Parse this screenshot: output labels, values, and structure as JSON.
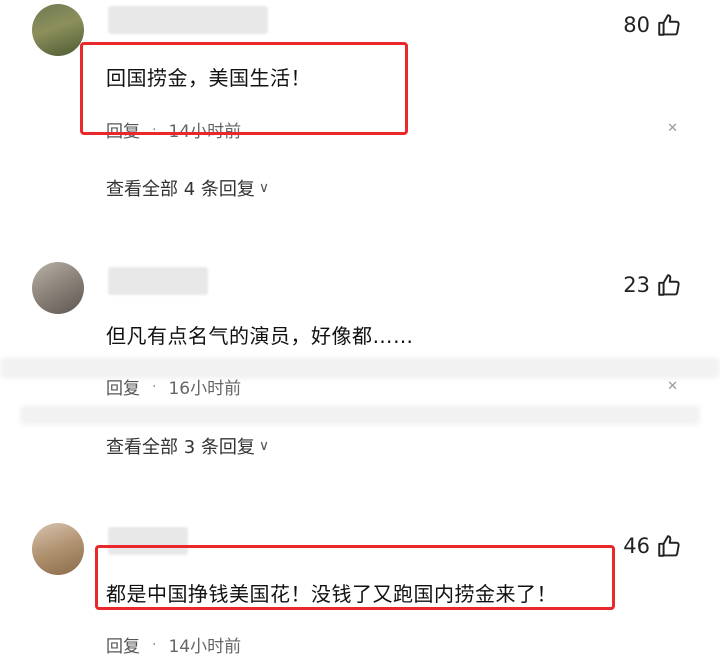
{
  "comments": [
    {
      "likes": "80",
      "text": "回国捞金，美国生活！",
      "reply_label": "回复",
      "time": "14小时前",
      "view_all": "查看全部 4 条回复"
    },
    {
      "likes": "23",
      "text": "但凡有点名气的演员，好像都……",
      "reply_label": "回复",
      "time": "16小时前",
      "view_all": "查看全部 3 条回复"
    },
    {
      "likes": "46",
      "text": "都是中国挣钱美国花！没钱了又跑国内捞金来了！",
      "reply_label": "回复",
      "time": "14小时前"
    }
  ],
  "colors": {
    "highlight": "#e8282a",
    "text": "#111111",
    "muted": "#666666"
  },
  "icons": {
    "like": "thumbs-up-icon",
    "close": "close-icon",
    "expand": "chevron-down-icon"
  }
}
